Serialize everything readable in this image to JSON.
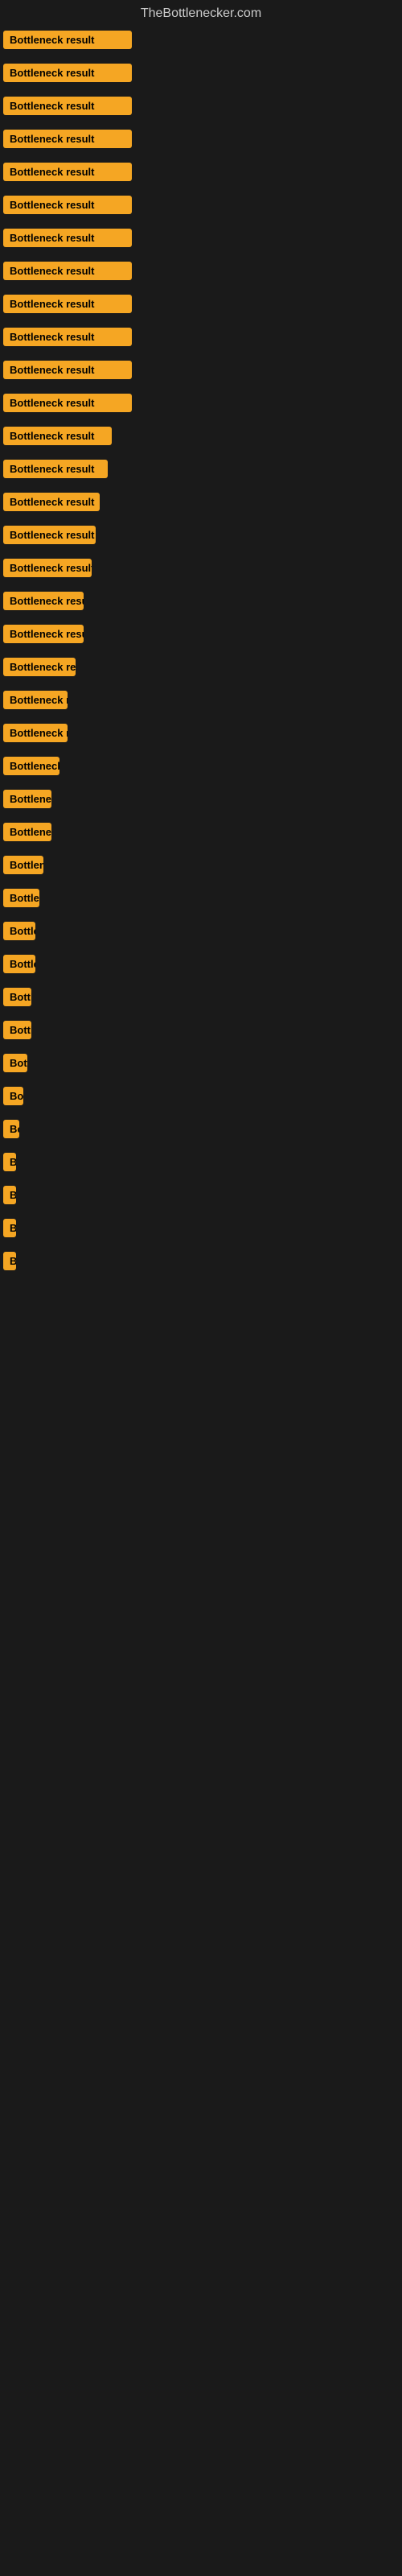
{
  "site": {
    "title": "TheBottlenecker.com"
  },
  "items": [
    {
      "label": "Bottleneck result",
      "width_class": "w-full"
    },
    {
      "label": "Bottleneck result",
      "width_class": "w-full"
    },
    {
      "label": "Bottleneck result",
      "width_class": "w-full"
    },
    {
      "label": "Bottleneck result",
      "width_class": "w-full"
    },
    {
      "label": "Bottleneck result",
      "width_class": "w-full"
    },
    {
      "label": "Bottleneck result",
      "width_class": "w-full"
    },
    {
      "label": "Bottleneck result",
      "width_class": "w-full"
    },
    {
      "label": "Bottleneck result",
      "width_class": "w-full"
    },
    {
      "label": "Bottleneck result",
      "width_class": "w-full"
    },
    {
      "label": "Bottleneck result",
      "width_class": "w-full"
    },
    {
      "label": "Bottleneck result",
      "width_class": "w-full"
    },
    {
      "label": "Bottleneck result",
      "width_class": "w-full"
    },
    {
      "label": "Bottleneck result",
      "width_class": "w-135"
    },
    {
      "label": "Bottleneck result",
      "width_class": "w-130"
    },
    {
      "label": "Bottleneck result",
      "width_class": "w-120"
    },
    {
      "label": "Bottleneck result",
      "width_class": "w-115"
    },
    {
      "label": "Bottleneck result",
      "width_class": "w-110"
    },
    {
      "label": "Bottleneck result",
      "width_class": "w-100"
    },
    {
      "label": "Bottleneck result",
      "width_class": "w-100"
    },
    {
      "label": "Bottleneck result",
      "width_class": "w-90"
    },
    {
      "label": "Bottleneck result",
      "width_class": "w-80"
    },
    {
      "label": "Bottleneck result",
      "width_class": "w-80"
    },
    {
      "label": "Bottleneck result",
      "width_class": "w-70"
    },
    {
      "label": "Bottleneck result",
      "width_class": "w-60"
    },
    {
      "label": "Bottleneck result",
      "width_class": "w-60"
    },
    {
      "label": "Bottleneck result",
      "width_class": "w-50"
    },
    {
      "label": "Bottleneck result",
      "width_class": "w-45"
    },
    {
      "label": "Bottleneck result",
      "width_class": "w-40"
    },
    {
      "label": "Bottleneck result",
      "width_class": "w-40"
    },
    {
      "label": "Bottleneck result",
      "width_class": "w-35"
    },
    {
      "label": "Bottleneck result",
      "width_class": "w-35"
    },
    {
      "label": "Bottleneck result",
      "width_class": "w-30"
    },
    {
      "label": "Bottleneck result",
      "width_class": "w-25"
    },
    {
      "label": "Bottleneck result",
      "width_class": "w-20"
    },
    {
      "label": "Bottleneck result",
      "width_class": "w-15"
    },
    {
      "label": "Bottleneck result",
      "width_class": "w-10"
    },
    {
      "label": "Bottleneck result",
      "width_class": "w-8"
    },
    {
      "label": "Bottleneck result",
      "width_class": "w-5"
    }
  ]
}
